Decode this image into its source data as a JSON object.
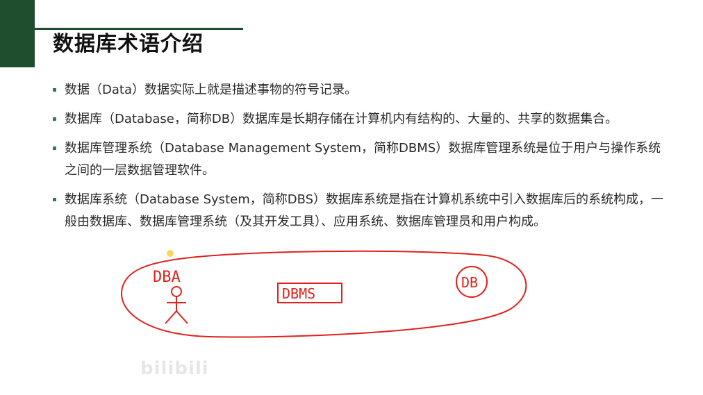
{
  "slide": {
    "title": "数据库术语介绍",
    "accent_color": "#1f4e2e",
    "bullet_color": "#2e7d4f",
    "items": [
      {
        "text": "数据（Data）数据实际上就是描述事物的符号记录。"
      },
      {
        "text": "数据库（Database，简称DB）数据库是长期存储在计算机内有结构的、大量的、共享的数据集合。"
      },
      {
        "text": "数据库管理系统（Database Management System，简称DBMS）数据库管理系统是位于用户与操作系统之间的一层数据管理软件。"
      },
      {
        "text": "数据库系统（Database System，简称DBS）数据库系统是指在计算机系统中引入数据库后的系统构成，一般由数据库、数据库管理系统（及其开发工具）、应用系统、数据库管理员和用户构成。"
      }
    ]
  },
  "annotation": {
    "color": "#e0201b",
    "label_dba": "DBA",
    "label_dbms": "DBMS",
    "label_db": "DB"
  },
  "watermark": {
    "logo_text": "bilibili"
  }
}
